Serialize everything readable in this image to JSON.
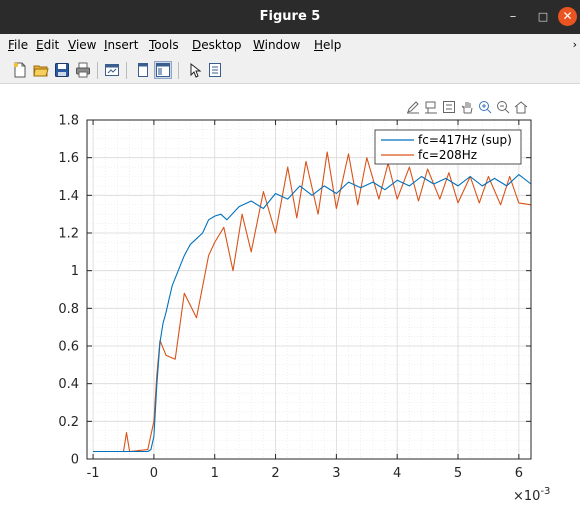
{
  "window": {
    "title": "Figure 5",
    "minimize": "–",
    "maximize": "□",
    "close": "✕"
  },
  "menu": {
    "items": [
      {
        "key": "F",
        "rest": "ile"
      },
      {
        "key": "E",
        "rest": "dit"
      },
      {
        "key": "V",
        "rest": "iew"
      },
      {
        "key": "I",
        "rest": "nsert"
      },
      {
        "key": "T",
        "rest": "ools"
      },
      {
        "key": "D",
        "rest": "esktop"
      },
      {
        "key": "W",
        "rest": "indow"
      },
      {
        "key": "H",
        "rest": "elp"
      }
    ],
    "overflow": "›"
  },
  "toolbar_icons": [
    "new-figure-icon",
    "open-file-icon",
    "save-icon",
    "print-icon",
    "link-plot-icon",
    "hide-plot-tools-icon",
    "show-plot-tools-icon",
    "edit-plot-icon",
    "property-inspector-icon"
  ],
  "axes_toolbar_icons": [
    "brush-icon",
    "data-cursor-icon",
    "legend-toggle-icon",
    "pan-hand-icon",
    "zoom-in-icon",
    "zoom-out-icon",
    "home-icon"
  ],
  "chart_data": {
    "type": "line",
    "title": "",
    "xlabel": "",
    "ylabel": "",
    "x_exponent_label": "×10",
    "x_exponent": "-3",
    "xlim": [
      -1.1,
      6.2
    ],
    "ylim": [
      0,
      1.8
    ],
    "xticks": [
      -1,
      0,
      1,
      2,
      3,
      4,
      5,
      6
    ],
    "yticks": [
      0,
      0.2,
      0.4,
      0.6,
      0.8,
      1,
      1.2,
      1.4,
      1.6,
      1.8
    ],
    "grid": true,
    "minor_grid": true,
    "legend_position": "top-right",
    "series": [
      {
        "name": "fc=417Hz (sup)",
        "color": "#0072bd",
        "x": [
          -1.0,
          -0.6,
          -0.1,
          -0.05,
          0.0,
          0.05,
          0.1,
          0.15,
          0.2,
          0.25,
          0.3,
          0.4,
          0.5,
          0.6,
          0.7,
          0.8,
          0.9,
          1.0,
          1.1,
          1.2,
          1.4,
          1.6,
          1.8,
          2.0,
          2.2,
          2.4,
          2.6,
          2.8,
          3.0,
          3.2,
          3.4,
          3.6,
          3.8,
          4.0,
          4.2,
          4.4,
          4.6,
          4.8,
          5.0,
          5.2,
          5.4,
          5.6,
          5.8,
          6.0,
          6.2
        ],
        "y": [
          0.04,
          0.04,
          0.04,
          0.05,
          0.12,
          0.4,
          0.62,
          0.72,
          0.78,
          0.85,
          0.92,
          1.0,
          1.08,
          1.14,
          1.17,
          1.2,
          1.27,
          1.29,
          1.3,
          1.27,
          1.34,
          1.37,
          1.33,
          1.41,
          1.38,
          1.45,
          1.4,
          1.45,
          1.41,
          1.47,
          1.44,
          1.47,
          1.43,
          1.48,
          1.45,
          1.5,
          1.46,
          1.49,
          1.45,
          1.5,
          1.45,
          1.49,
          1.45,
          1.51,
          1.46
        ]
      },
      {
        "name": "fc=208Hz",
        "color": "#d95319",
        "x": [
          -1.0,
          -0.5,
          -0.45,
          -0.4,
          -0.1,
          0.0,
          0.05,
          0.1,
          0.2,
          0.35,
          0.5,
          0.7,
          0.9,
          1.0,
          1.15,
          1.3,
          1.45,
          1.6,
          1.8,
          2.0,
          2.2,
          2.35,
          2.5,
          2.7,
          2.85,
          3.0,
          3.2,
          3.35,
          3.5,
          3.7,
          3.85,
          4.0,
          4.2,
          4.35,
          4.5,
          4.7,
          4.85,
          5.0,
          5.2,
          5.35,
          5.5,
          5.7,
          5.85,
          6.0,
          6.2
        ],
        "y": [
          0.04,
          0.04,
          0.14,
          0.04,
          0.05,
          0.2,
          0.45,
          0.63,
          0.55,
          0.53,
          0.88,
          0.75,
          1.08,
          1.15,
          1.23,
          1.0,
          1.3,
          1.1,
          1.42,
          1.2,
          1.55,
          1.28,
          1.58,
          1.3,
          1.63,
          1.33,
          1.62,
          1.35,
          1.6,
          1.38,
          1.57,
          1.38,
          1.55,
          1.37,
          1.54,
          1.38,
          1.52,
          1.36,
          1.5,
          1.36,
          1.5,
          1.35,
          1.5,
          1.36,
          1.35
        ]
      }
    ]
  }
}
